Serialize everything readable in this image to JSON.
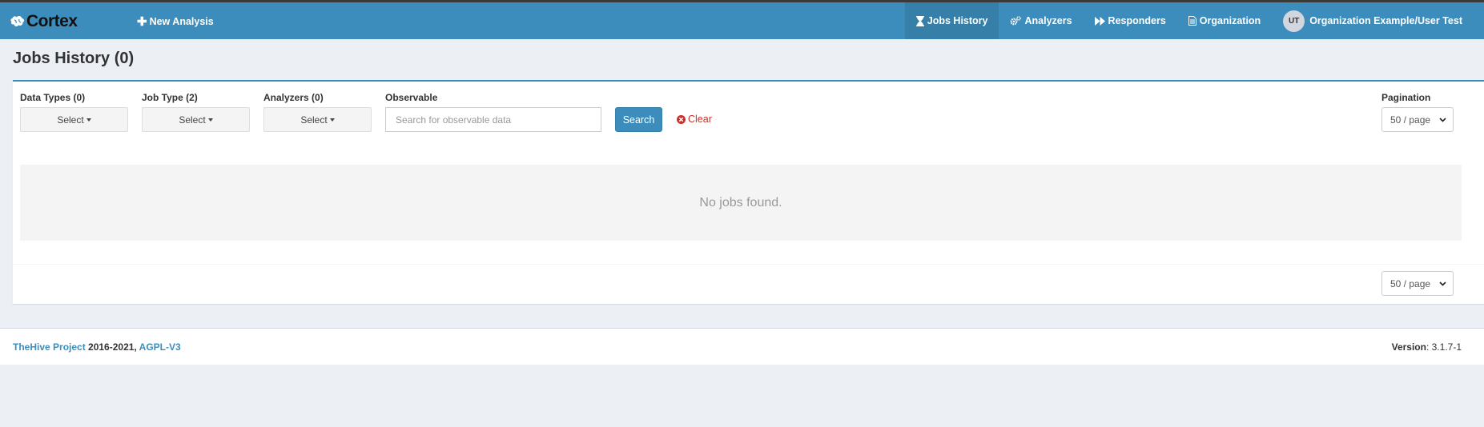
{
  "navbar": {
    "brand": "Cortex",
    "new_analysis": "New Analysis",
    "items": [
      {
        "label": "Jobs History",
        "icon": "hourglass-icon",
        "active": true
      },
      {
        "label": "Analyzers",
        "icon": "cogs-icon",
        "active": false
      },
      {
        "label": "Responders",
        "icon": "fast-forward-icon",
        "active": false
      },
      {
        "label": "Organization",
        "icon": "document-icon",
        "active": false
      }
    ],
    "user": {
      "initials": "UT",
      "label": "Organization Example/User Test"
    },
    "color": "#3c8dbc",
    "active_color": "#367fa9"
  },
  "page": {
    "title": "Jobs History (0)"
  },
  "filters": {
    "data_types": {
      "label": "Data Types (0)",
      "value": "Select"
    },
    "job_type": {
      "label": "Job Type (2)",
      "value": "Select"
    },
    "analyzers": {
      "label": "Analyzers (0)",
      "value": "Select"
    },
    "observable": {
      "label": "Observable",
      "placeholder": "Search for observable data",
      "value": ""
    },
    "search_button": "Search",
    "clear_link": "Clear",
    "pagination": {
      "label": "Pagination",
      "value": "50 / page"
    }
  },
  "results": {
    "empty_message": "No jobs found.",
    "bottom_pagination": "50 / page"
  },
  "footer": {
    "project_link": "TheHive Project",
    "years": " 2016-2021, ",
    "license_link": "AGPL-V3",
    "version_label": "Version",
    "version_value": ": 3.1.7-1"
  }
}
